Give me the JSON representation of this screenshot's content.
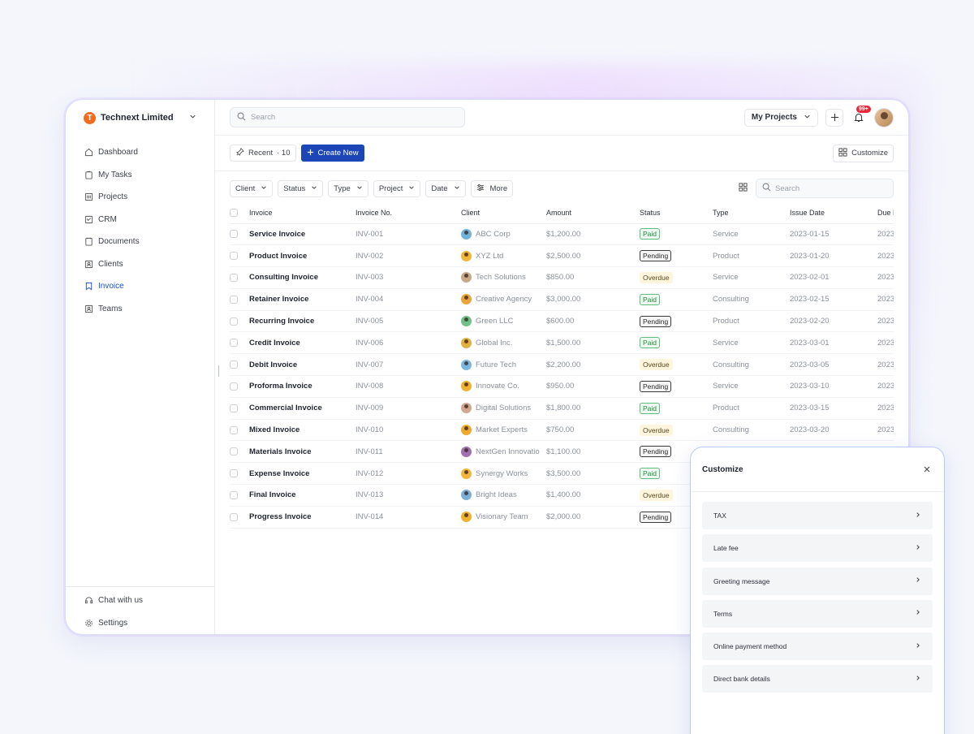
{
  "org": {
    "initial": "T",
    "name": "Technext Limited"
  },
  "nav": [
    {
      "label": "Dashboard",
      "icon": "home-icon"
    },
    {
      "label": "My Tasks",
      "icon": "clipboard-icon"
    },
    {
      "label": "Projects",
      "icon": "projects-icon"
    },
    {
      "label": "CRM",
      "icon": "crm-icon"
    },
    {
      "label": "Documents",
      "icon": "document-icon"
    },
    {
      "label": "Clients",
      "icon": "clients-icon"
    },
    {
      "label": "Invoice",
      "icon": "bookmark-icon",
      "active": true
    },
    {
      "label": "Teams",
      "icon": "teams-icon"
    }
  ],
  "sidebar_bottom": [
    {
      "label": "Chat with us",
      "icon": "headset-icon"
    },
    {
      "label": "Settings",
      "icon": "gear-icon"
    }
  ],
  "topbar": {
    "search_placeholder": "Search",
    "projects_label": "My Projects",
    "notif_count": "99+"
  },
  "toolbar": {
    "recent_label": "Recent",
    "recent_count": "· 10",
    "create_label": "Create New",
    "customize_label": "Customize"
  },
  "filters": [
    "Client",
    "Status",
    "Type",
    "Project",
    "Date"
  ],
  "more_label": "More",
  "table_search_placeholder": "Search",
  "table": {
    "headers": [
      "Invoice",
      "Invoice No.",
      "Client",
      "Amount",
      "Status",
      "Type",
      "Issue Date",
      "Due D"
    ],
    "rows": [
      [
        "Service Invoice",
        "INV-001",
        "ABC Corp",
        "$1,200.00",
        "Paid",
        "Service",
        "2023-01-15",
        "2023"
      ],
      [
        "Product Invoice",
        "INV-002",
        "XYZ Ltd",
        "$2,500.00",
        "Pending",
        "Product",
        "2023-01-20",
        "2023"
      ],
      [
        "Consulting Invoice",
        "INV-003",
        "Tech Solutions",
        "$850.00",
        "Overdue",
        "Service",
        "2023-02-01",
        "2023"
      ],
      [
        "Retainer Invoice",
        "INV-004",
        "Creative Agency",
        "$3,000.00",
        "Paid",
        "Consulting",
        "2023-02-15",
        "2023"
      ],
      [
        "Recurring Invoice",
        "INV-005",
        "Green LLC",
        "$600.00",
        "Pending",
        "Product",
        "2023-02-20",
        "2023"
      ],
      [
        "Credit Invoice",
        "INV-006",
        "Global Inc.",
        "$1,500.00",
        "Paid",
        "Service",
        "2023-03-01",
        "2023"
      ],
      [
        "Debit Invoice",
        "INV-007",
        "Future Tech",
        "$2,200.00",
        "Overdue",
        "Consulting",
        "2023-03-05",
        "2023"
      ],
      [
        "Proforma Invoice",
        "INV-008",
        "Innovate Co.",
        "$950.00",
        "Pending",
        "Service",
        "2023-03-10",
        "2023"
      ],
      [
        "Commercial Invoice",
        "INV-009",
        "Digital Solutions",
        "$1,800.00",
        "Paid",
        "Product",
        "2023-03-15",
        "2023"
      ],
      [
        "Mixed Invoice",
        "INV-010",
        "Market Experts",
        "$750.00",
        "Overdue",
        "Consulting",
        "2023-03-20",
        "2023"
      ],
      [
        "Materials Invoice",
        "INV-011",
        "NextGen Innovatio",
        "$1,100.00",
        "Pending",
        "",
        "",
        ""
      ],
      [
        "Expense Invoice",
        "INV-012",
        "Synergy Works",
        "$3,500.00",
        "Paid",
        "",
        "",
        ""
      ],
      [
        "Final Invoice",
        "INV-013",
        "Bright Ideas",
        "$1,400.00",
        "Overdue",
        "",
        "",
        ""
      ],
      [
        "Progress Invoice",
        "INV-014",
        "Visionary Team",
        "$2,000.00",
        "Pending",
        "",
        "",
        ""
      ]
    ]
  },
  "avatar_colors": [
    "#6fb3d9",
    "#f2b53a",
    "#c9a88a",
    "#e9a33a",
    "#6fc08a",
    "#e0b040",
    "#7ab8e0",
    "#f0b030",
    "#d0a890",
    "#f0a830",
    "#a070b0",
    "#f2b53a",
    "#7ab0d8",
    "#f0b030"
  ],
  "customize": {
    "title": "Customize",
    "items": [
      "TAX",
      "Late fee",
      "Greeting message",
      "Terms",
      "Online payment method",
      "Direct bank details"
    ]
  }
}
